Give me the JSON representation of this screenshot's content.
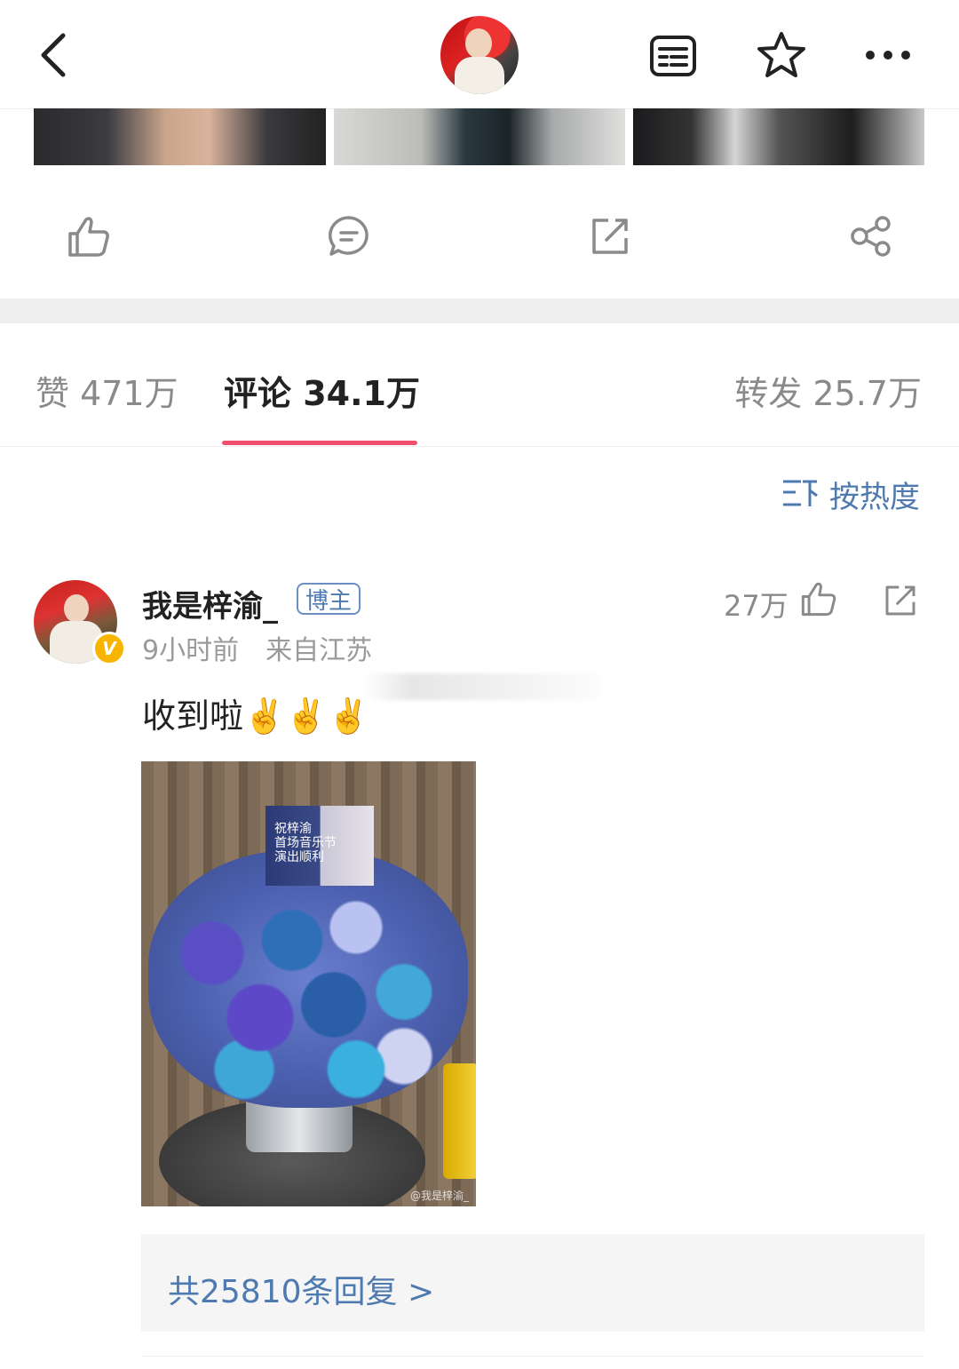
{
  "header": {
    "back_icon": "chevron-left-icon",
    "menu_icon": "article-list-icon",
    "favorite_icon": "star-icon",
    "more_icon": "ellipsis-icon"
  },
  "actions": {
    "like_icon": "thumb-up-icon",
    "comment_icon": "comment-icon",
    "repost_icon": "repost-icon",
    "share_icon": "share-icon"
  },
  "tabs": [
    {
      "label": "赞 471万"
    },
    {
      "label": "评论 34.1万"
    },
    {
      "label": "转发 25.7万"
    }
  ],
  "sort": {
    "label": "按热度",
    "icon": "sort-icon"
  },
  "comment": {
    "username": "我是梓渝_",
    "badge": "博主",
    "verified": "V",
    "time": "9小时前",
    "location": "来自江苏",
    "likes": "27万",
    "text": "收到啦✌️✌️✌️",
    "photo_card_text": "祝梓渝\n首场音乐节\n演出顺利",
    "photo_watermark": "@我是梓渝_",
    "replies": "共25810条回复 >"
  },
  "colors": {
    "accent": "#f0506e",
    "link": "#4f7ab0",
    "verified": "#f7b500"
  }
}
